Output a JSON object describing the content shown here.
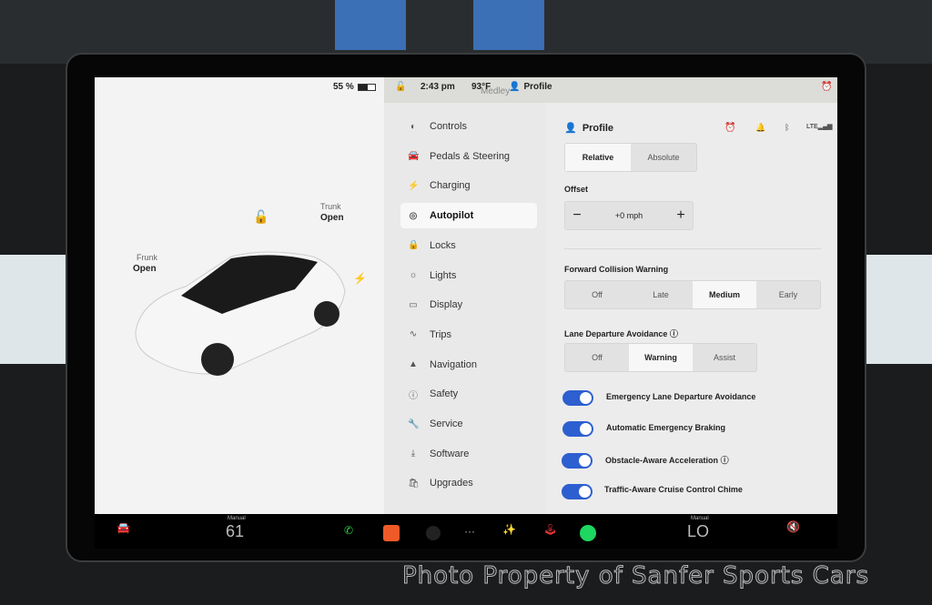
{
  "status": {
    "battery": "55 %",
    "time": "2:43 pm",
    "temp": "93°F",
    "map_label": "Medley",
    "profile": "Profile"
  },
  "car": {
    "frunk_label": "Frunk",
    "frunk_state": "Open",
    "trunk_label": "Trunk",
    "trunk_state": "Open"
  },
  "menu": [
    {
      "label": "Controls",
      "icon": "toggle-icon"
    },
    {
      "label": "Pedals & Steering",
      "icon": "car-icon"
    },
    {
      "label": "Charging",
      "icon": "bolt-icon"
    },
    {
      "label": "Autopilot",
      "icon": "steering-wheel-icon",
      "active": true
    },
    {
      "label": "Locks",
      "icon": "lock-icon"
    },
    {
      "label": "Lights",
      "icon": "sun-icon"
    },
    {
      "label": "Display",
      "icon": "display-icon"
    },
    {
      "label": "Trips",
      "icon": "trips-icon"
    },
    {
      "label": "Navigation",
      "icon": "navigation-icon"
    },
    {
      "label": "Safety",
      "icon": "safety-icon"
    },
    {
      "label": "Service",
      "icon": "wrench-icon"
    },
    {
      "label": "Software",
      "icon": "download-icon"
    },
    {
      "label": "Upgrades",
      "icon": "bag-icon"
    }
  ],
  "content": {
    "profile": "Profile",
    "speed_mode": {
      "options": [
        "Relative",
        "Absolute"
      ],
      "selected": "Relative"
    },
    "offset_label": "Offset",
    "offset_value": "+0 mph",
    "minus": "−",
    "plus": "+",
    "fcw_label": "Forward Collision Warning",
    "fcw": {
      "options": [
        "Off",
        "Late",
        "Medium",
        "Early"
      ],
      "selected": "Medium"
    },
    "lda_label": "Lane Departure Avoidance",
    "lda": {
      "options": [
        "Off",
        "Warning",
        "Assist"
      ],
      "selected": "Warning"
    },
    "toggles": [
      {
        "label": "Emergency Lane Departure Avoidance",
        "on": true
      },
      {
        "label": "Automatic Emergency Braking",
        "on": true
      },
      {
        "label": "Obstacle-Aware Acceleration",
        "on": true
      },
      {
        "label": "Traffic-Aware Cruise Control Chime",
        "on": true
      }
    ]
  },
  "bottom": {
    "left_mode": "Manual",
    "left_temp": "61",
    "right_mode": "Manual",
    "right_temp": "LO"
  },
  "watermark": "Photo Property of Sanfer Sports Cars",
  "colors": {
    "accent": "#2d5fd0",
    "alarm": "#e39a2b",
    "spotify": "#1ed760",
    "phone": "#2ecc40"
  }
}
